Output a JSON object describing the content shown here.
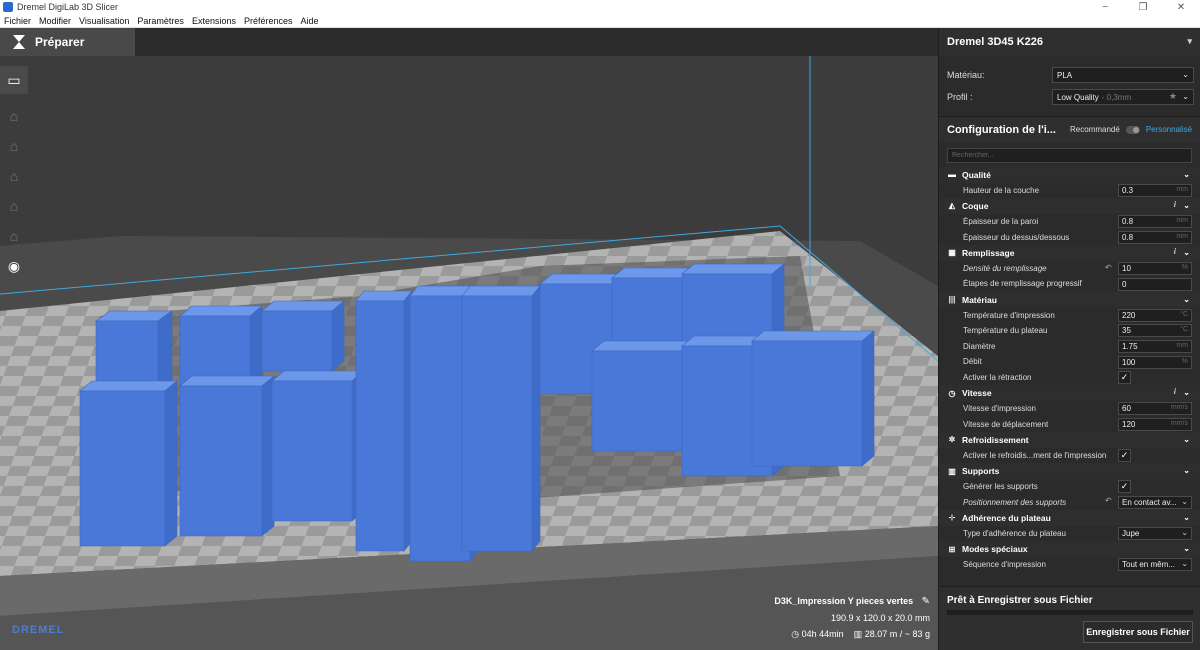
{
  "window": {
    "title": "Dremel DigiLab 3D Slicer",
    "controls": [
      "−",
      "❐",
      "✕"
    ]
  },
  "menu": [
    "Fichier",
    "Modifier",
    "Visualisation",
    "Paramètres",
    "Extensions",
    "Préférences",
    "Aide"
  ],
  "header": {
    "prepare_label": "Préparer"
  },
  "toolbar": {
    "icons": [
      "folder-open-icon",
      "move-icon",
      "scale-icon",
      "rotate-icon",
      "mirror-icon",
      "per-model-settings-icon",
      "eye-icon"
    ]
  },
  "viewport": {
    "brand": "DREMEL",
    "job_name": "D3K_Impression Y pieces vertes",
    "dimensions": "190.9 x 120.0 x 20.0 mm",
    "print_time": "04h 44min",
    "material_usage": "28.07 m / ~ 83 g",
    "model_color": "#4a78d8"
  },
  "panel": {
    "printer": "Dremel 3D45 K226",
    "material_label": "Matériau:",
    "material_value": "PLA",
    "profile_label": "Profil :",
    "profile_value": "Low Quality",
    "profile_sub": "- 0,3mm",
    "config_title": "Configuration de l'i...",
    "recommended": "Recommandé",
    "custom": "Personnalisé",
    "search_placeholder": "Rechercher...",
    "sections": [
      {
        "title": "Qualité",
        "icon": "▬",
        "info": false,
        "settings": [
          {
            "label": "Hauteur de la couche",
            "value": "0.3",
            "unit": "mm"
          }
        ]
      },
      {
        "title": "Coque",
        "icon": "◭",
        "info": true,
        "settings": [
          {
            "label": "Épaisseur de la paroi",
            "value": "0.8",
            "unit": "mm"
          },
          {
            "label": "Épaisseur du dessus/dessous",
            "value": "0.8",
            "unit": "mm"
          }
        ]
      },
      {
        "title": "Remplissage",
        "icon": "▦",
        "info": true,
        "settings": [
          {
            "label": "Densité du remplissage",
            "value": "10",
            "unit": "%",
            "italic": true,
            "reset": true
          },
          {
            "label": "Étapes de remplissage progressif",
            "value": "0",
            "unit": ""
          }
        ]
      },
      {
        "title": "Matériau",
        "icon": "|||",
        "info": false,
        "settings": [
          {
            "label": "Température d'impression",
            "value": "220",
            "unit": "°C"
          },
          {
            "label": "Température du plateau",
            "value": "35",
            "unit": "°C"
          },
          {
            "label": "Diamètre",
            "value": "1.75",
            "unit": "mm"
          },
          {
            "label": "Débit",
            "value": "100",
            "unit": "%"
          },
          {
            "label": "Activer la rétraction",
            "check": true
          }
        ]
      },
      {
        "title": "Vitesse",
        "icon": "◷",
        "info": true,
        "settings": [
          {
            "label": "Vitesse d'impression",
            "value": "60",
            "unit": "mm/s"
          },
          {
            "label": "Vitesse de déplacement",
            "value": "120",
            "unit": "mm/s"
          }
        ]
      },
      {
        "title": "Refroidissement",
        "icon": "✲",
        "info": false,
        "settings": [
          {
            "label": "Activer le refroidis...ment de l'impression",
            "check": true
          }
        ]
      },
      {
        "title": "Supports",
        "icon": "▥",
        "info": false,
        "settings": [
          {
            "label": "Générer les supports",
            "check": true
          },
          {
            "label": "Positionnement des supports",
            "value": "En contact av...",
            "select": true,
            "italic": true,
            "reset": true
          }
        ]
      },
      {
        "title": "Adhérence du plateau",
        "icon": "⊹",
        "info": false,
        "settings": [
          {
            "label": "Type d'adhérence du plateau",
            "value": "Jupe",
            "select": true
          }
        ]
      },
      {
        "title": "Modes spéciaux",
        "icon": "⊞",
        "info": false,
        "settings": [
          {
            "label": "Séquence d'impression",
            "value": "Tout en mêm...",
            "select": true
          }
        ]
      }
    ],
    "save_title": "Prêt à Enregistrer sous Fichier",
    "save_button": "Enregistrer sous Fichier"
  }
}
